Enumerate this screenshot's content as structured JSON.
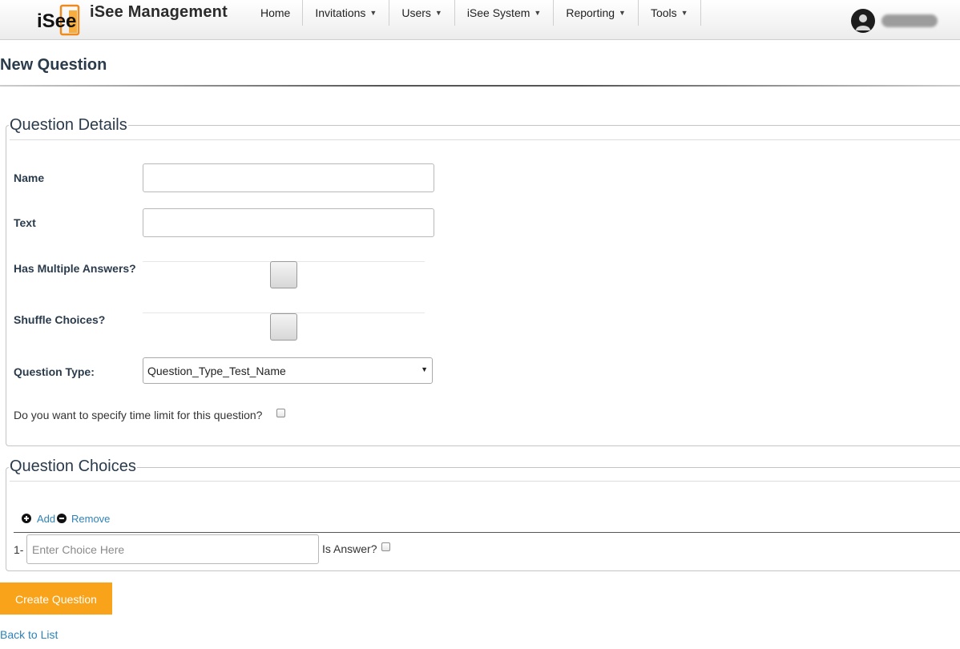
{
  "header": {
    "logo_text": "iSee",
    "brand": "iSee Management",
    "nav": [
      {
        "label": "Home",
        "has_dropdown": false
      },
      {
        "label": "Invitations",
        "has_dropdown": true
      },
      {
        "label": "Users",
        "has_dropdown": true
      },
      {
        "label": "iSee System",
        "has_dropdown": true
      },
      {
        "label": "Reporting",
        "has_dropdown": true
      },
      {
        "label": "Tools",
        "has_dropdown": true
      }
    ],
    "caret_glyph": "▼"
  },
  "page": {
    "title": "New Question"
  },
  "details": {
    "legend": "Question Details",
    "name_label": "Name",
    "name_value": "",
    "text_label": "Text",
    "text_value": "",
    "multiple_answers_label": "Has Multiple Answers?",
    "shuffle_label": "Shuffle Choices?",
    "type_label": "Question Type:",
    "type_selected": "Question_Type_Test_Name",
    "time_limit_label": "Do you want to specify time limit for this question?"
  },
  "choices": {
    "legend": "Question Choices",
    "add_label": "Add",
    "remove_label": "Remove",
    "rows": [
      {
        "number": "1-",
        "value": "",
        "placeholder": "Enter Choice Here",
        "is_answer_label": "Is Answer?"
      }
    ]
  },
  "actions": {
    "create_label": "Create Question",
    "back_label": "Back to List"
  },
  "colors": {
    "accent": "#f9a31a",
    "link": "#2d83b8",
    "heading": "#2a3b4c"
  }
}
